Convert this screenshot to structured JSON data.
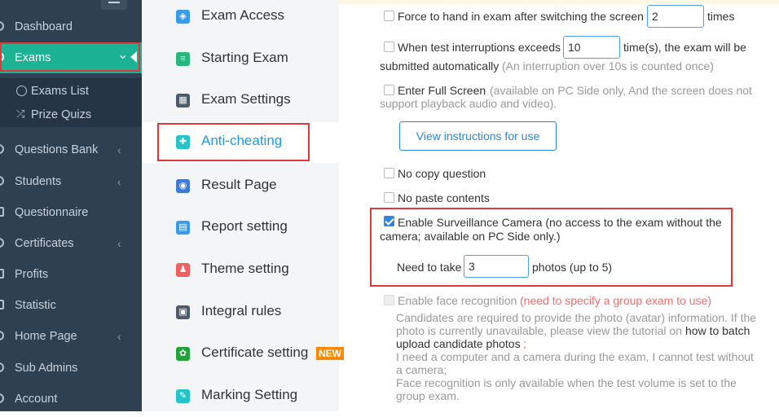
{
  "sidebar": {
    "items": [
      {
        "label": "Dashboard",
        "icon": "dashboard-icon"
      },
      {
        "label": "Exams",
        "icon": "exams-icon",
        "chevron": "⌄"
      },
      {
        "label": "Questions Bank",
        "icon": "questions-bank-icon",
        "chevron": "‹"
      },
      {
        "label": "Students",
        "icon": "students-icon",
        "chevron": "‹"
      },
      {
        "label": "Questionnaire",
        "icon": "questionnaire-icon"
      },
      {
        "label": "Certificates",
        "icon": "certificates-icon",
        "chevron": "‹"
      },
      {
        "label": "Profits",
        "icon": "profits-icon"
      },
      {
        "label": "Statistic",
        "icon": "statistic-icon"
      },
      {
        "label": "Home Page",
        "icon": "home-page-icon",
        "chevron": "‹"
      },
      {
        "label": "Sub Admins",
        "icon": "sub-admins-icon"
      },
      {
        "label": "Account",
        "icon": "account-icon"
      }
    ],
    "sub_items": [
      {
        "label": "Exams List",
        "icon": "check-circle-icon"
      },
      {
        "label": "Prize Quizs",
        "icon": "shuffle-icon"
      }
    ]
  },
  "menu": {
    "items": [
      {
        "label": "Exam Access",
        "icon": "shield-icon",
        "color": "#3a9be8"
      },
      {
        "label": "Starting Exam",
        "icon": "document-icon",
        "color": "#28b67c"
      },
      {
        "label": "Exam Settings",
        "icon": "settings-grid-icon",
        "color": "#4c5a6a"
      },
      {
        "label": "Anti-cheating",
        "icon": "shield-plus-icon",
        "color": "#26c3c9"
      },
      {
        "label": "Result Page",
        "icon": "eye-icon",
        "color": "#3e7ad6"
      },
      {
        "label": "Report setting",
        "icon": "report-icon",
        "color": "#3a9be8"
      },
      {
        "label": "Theme setting",
        "icon": "tshirt-icon",
        "color": "#f06060"
      },
      {
        "label": "Integral rules",
        "icon": "integral-icon",
        "color": "#4c5a6a"
      },
      {
        "label": "Certificate setting",
        "icon": "certificate-icon",
        "color": "#21a33c",
        "badge": "NEW"
      },
      {
        "label": "Marking Setting",
        "icon": "marking-icon",
        "color": "#26c3c9"
      }
    ]
  },
  "content": {
    "force_hand_in": {
      "label": "Force to hand in exam after switching the screen",
      "value": "2",
      "suffix": "times"
    },
    "interruptions": {
      "label": "When test interruptions exceeds",
      "value": "10",
      "suffix": "time(s), the exam will be",
      "line2": "submitted automatically",
      "note": "(An interruption over 10s is counted once)"
    },
    "fullscreen": {
      "label": "Enter Full Screen",
      "note1": "(available on PC Side only, And the screen does not",
      "note2": "support playback audio and video)."
    },
    "instructions_button": "View instructions for use",
    "no_copy": "No copy question",
    "no_paste": "No paste contents",
    "camera": {
      "label": "Enable Surveillance Camera (no access to the exam without the",
      "line2": "camera; available on PC Side only.)",
      "take_label": "Need to take",
      "value": "3",
      "suffix": "photos (up to 5)"
    },
    "face": {
      "label": "Enable face recognition",
      "note": "(need to specify a group exam to use)",
      "desc1": "Candidates are required to provide the photo (avatar) information. If the",
      "desc2": "photo is currently unavailable, please view the tutorial on",
      "desc2_link": "how to batch",
      "desc3": "upload candidate photos",
      "desc3_end": ";",
      "desc4": "I need a computer and a camera during the exam, I cannot test without",
      "desc5": "a camera;",
      "desc6": "Face recognition is only available when the test volume is set to the",
      "desc7": "group exam."
    }
  },
  "colors": {
    "sidebar": "#2f4050",
    "active": "#1cb394",
    "accent": "#2d86e0",
    "highlight": "#e0363c"
  }
}
